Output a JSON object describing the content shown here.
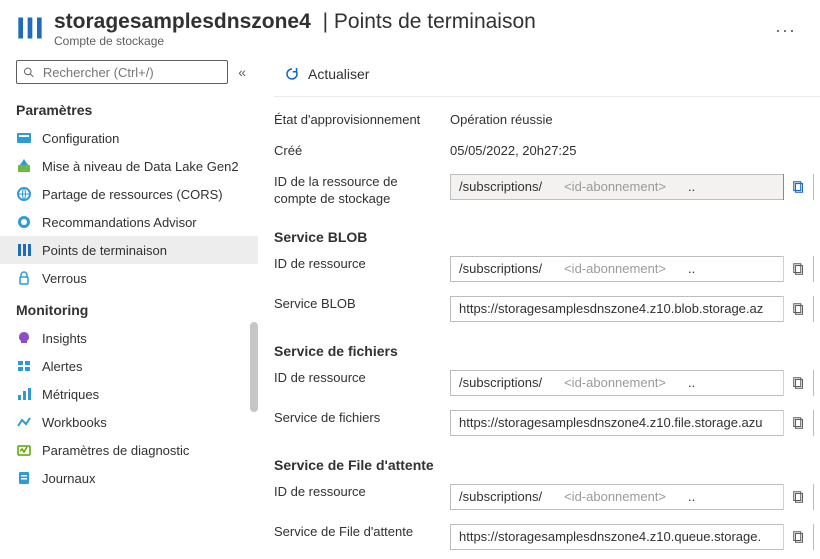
{
  "header": {
    "resource_name": "storagesamplesdnszone4",
    "page_title": "Points de terminaison",
    "resource_type": "Compte de stockage"
  },
  "search": {
    "placeholder": "Rechercher (Ctrl+/)"
  },
  "sidebar": {
    "sections": {
      "settings": {
        "title": "Paramètres",
        "items": [
          {
            "label": "Configuration"
          },
          {
            "label": "Mise à niveau de Data Lake Gen2"
          },
          {
            "label": "Partage de ressources (CORS)"
          },
          {
            "label": "Recommandations Advisor"
          },
          {
            "label": "Points de terminaison"
          },
          {
            "label": "Verrous"
          }
        ]
      },
      "monitoring": {
        "title": "Monitoring",
        "items": [
          {
            "label": "Insights"
          },
          {
            "label": "Alertes"
          },
          {
            "label": "Métriques"
          },
          {
            "label": "Workbooks"
          },
          {
            "label": "Paramètres de diagnostic"
          },
          {
            "label": "Journaux"
          }
        ]
      }
    }
  },
  "toolbar": {
    "refresh": "Actualiser"
  },
  "overview": {
    "provisioning_label": "État d'approvisionnement",
    "provisioning_value": "Opération réussie",
    "created_label": "Créé",
    "created_value": "05/05/2022, 20h27:25",
    "account_id_label": "ID de la ressource de compte de stockage",
    "sub_prefix": "/subscriptions/",
    "sub_id": "<id-abonnement>",
    "sub_suffix": ".."
  },
  "services": {
    "blob": {
      "title": "Service BLOB",
      "res_label": "ID de ressource",
      "ep_label": "Service BLOB",
      "endpoint": "https://storagesamplesdnszone4.z10.blob.storage.az"
    },
    "file": {
      "title": "Service de fichiers",
      "res_label": "ID de ressource",
      "ep_label": "Service de fichiers",
      "endpoint": "https://storagesamplesdnszone4.z10.file.storage.azu"
    },
    "queue": {
      "title": "Service de File d'attente",
      "res_label": "ID de ressource",
      "ep_label": "Service de File d'attente",
      "endpoint": "https://storagesamplesdnszone4.z10.queue.storage."
    }
  }
}
